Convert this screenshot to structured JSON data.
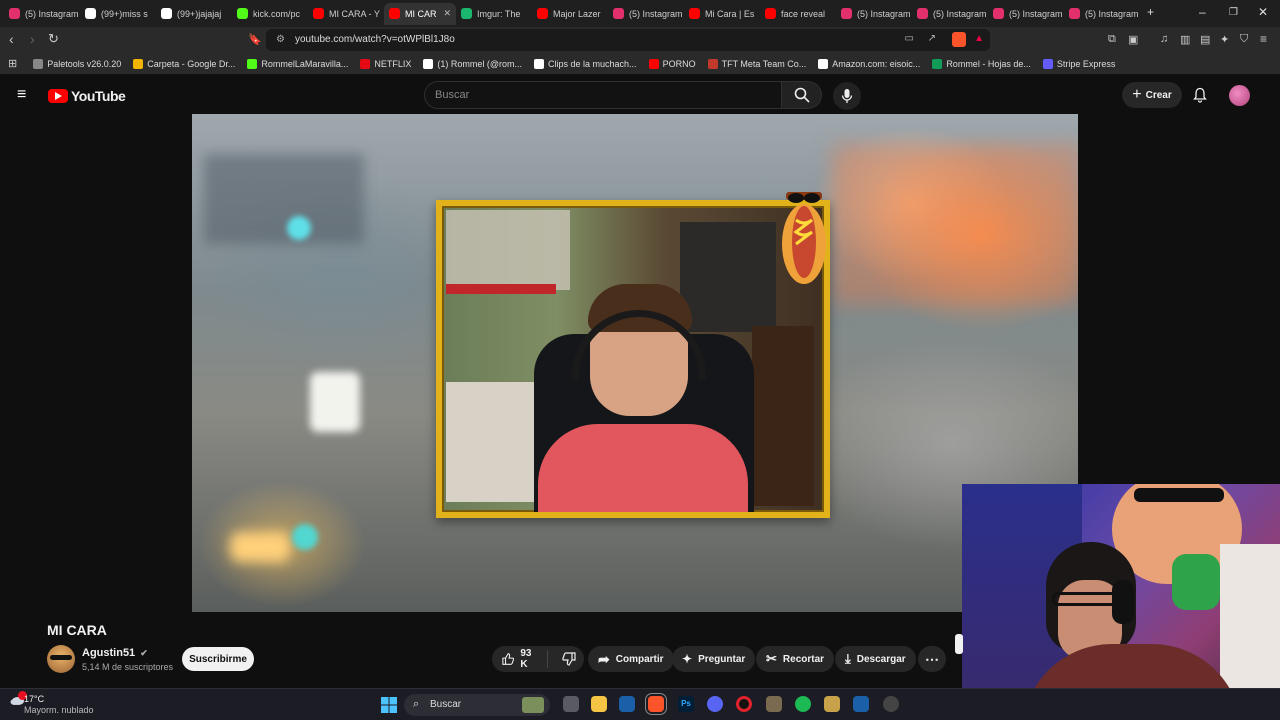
{
  "browser": {
    "tabs": [
      {
        "label": "(5) Instagram",
        "icon": "instagram-icon",
        "color": "#e1306c"
      },
      {
        "label": "(99+)miss s",
        "icon": "tiktok-icon",
        "color": "#ffffff"
      },
      {
        "label": "(99+)jajajaj",
        "icon": "tiktok-icon",
        "color": "#ffffff"
      },
      {
        "label": "kick.com/pc",
        "icon": "kick-icon",
        "color": "#53fc18"
      },
      {
        "label": "MI CARA - Y",
        "icon": "youtube-icon",
        "color": "#ff0000"
      },
      {
        "label": "MI CAR",
        "icon": "youtube-icon",
        "color": "#ff0000",
        "active": true
      },
      {
        "label": "Imgur: The",
        "icon": "imgur-icon",
        "color": "#1bb76e"
      },
      {
        "label": "Major Lazer",
        "icon": "youtube-icon",
        "color": "#ff0000"
      },
      {
        "label": "(5) Instagram",
        "icon": "instagram-icon",
        "color": "#e1306c"
      },
      {
        "label": "Mi Cara | Es",
        "icon": "youtube-icon",
        "color": "#ff0000"
      },
      {
        "label": "face reveal",
        "icon": "youtube-icon",
        "color": "#ff0000"
      },
      {
        "label": "(5) Instagram",
        "icon": "instagram-icon",
        "color": "#e1306c"
      },
      {
        "label": "(5) Instagram",
        "icon": "instagram-icon",
        "color": "#e1306c"
      },
      {
        "label": "(5) Instagram",
        "icon": "instagram-icon",
        "color": "#e1306c"
      },
      {
        "label": "(5) Instagram",
        "icon": "instagram-icon",
        "color": "#e1306c"
      }
    ],
    "url": "youtube.com/watch?v=otWPlBl1J8o",
    "bookmarks": [
      {
        "label": "Paletools v26.0.20",
        "color": "#888888"
      },
      {
        "label": "Carpeta - Google Dr...",
        "color": "#f4b400"
      },
      {
        "label": "RommelLaMaravilla...",
        "color": "#53fc18"
      },
      {
        "label": "NETFLIX",
        "color": "#e50914"
      },
      {
        "label": "(1) Rommel (@rom...",
        "color": "#ffffff"
      },
      {
        "label": "Clips de la muchach...",
        "color": "#ffffff"
      },
      {
        "label": "PORNO",
        "color": "#ff0000"
      },
      {
        "label": "TFT Meta Team Co...",
        "color": "#c0392b"
      },
      {
        "label": "Amazon.com: eisoic...",
        "color": "#ffffff"
      },
      {
        "label": "Rommel - Hojas de...",
        "color": "#0f9d58"
      },
      {
        "label": "Stripe Express",
        "color": "#635bff"
      }
    ]
  },
  "youtube": {
    "logo_text": "YouTube",
    "search_placeholder": "Buscar",
    "create_label": "Crear",
    "video_title": "MI CARA",
    "channel_name": "Agustin51",
    "subscribers": "5,14 M de suscriptores",
    "subscribe_label": "Suscribirme",
    "likes": "93 K",
    "actions": {
      "share": "Compartir",
      "ask": "Preguntar",
      "clip": "Recortar",
      "download": "Descargar"
    },
    "accent": "#ff0000"
  },
  "taskbar": {
    "temperature": "17°C",
    "weather": "Mayorm. nublado",
    "search_label": "Buscar"
  }
}
